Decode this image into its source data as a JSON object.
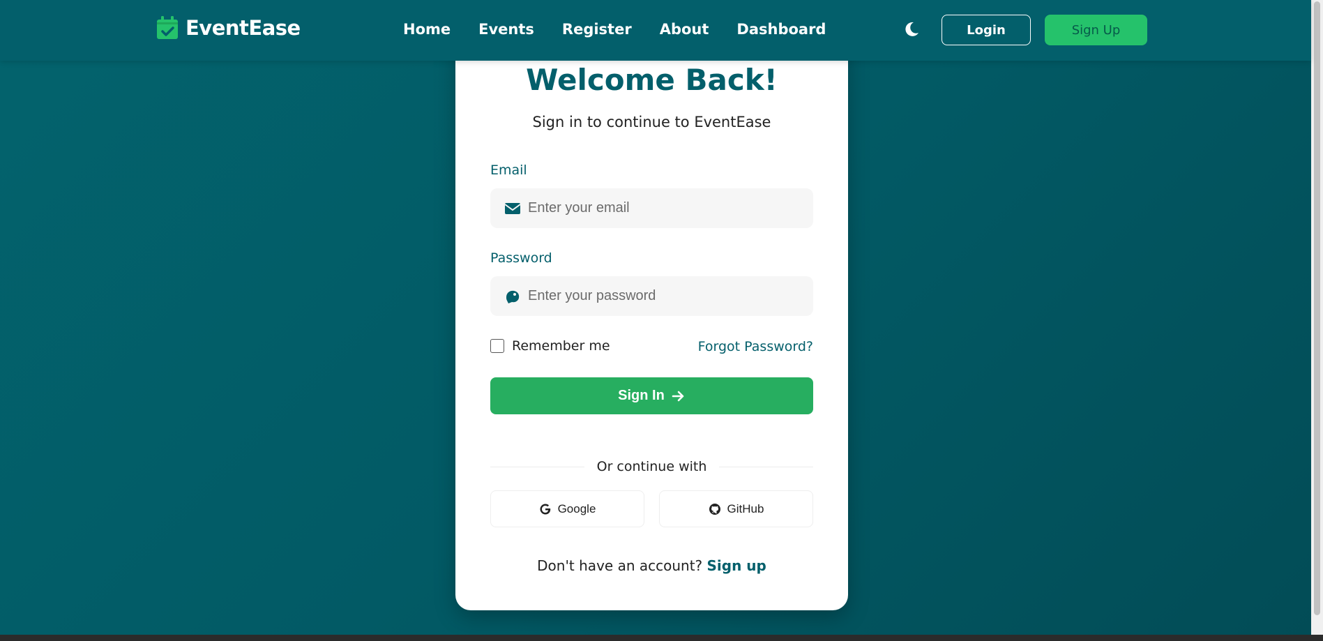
{
  "brand": {
    "name": "EventEase",
    "icon": "calendar-check-icon"
  },
  "nav": {
    "items": [
      {
        "label": "Home"
      },
      {
        "label": "Events"
      },
      {
        "label": "Register"
      },
      {
        "label": "About"
      },
      {
        "label": "Dashboard"
      }
    ],
    "theme_icon": "moon-icon",
    "login_label": "Login",
    "signup_label": "Sign Up"
  },
  "card": {
    "title": "Welcome Back!",
    "subtitle": "Sign in to continue to EventEase",
    "email": {
      "label": "Email",
      "placeholder": "Enter your email",
      "icon": "envelope-icon"
    },
    "password": {
      "label": "Password",
      "placeholder": "Enter your password",
      "icon": "key-icon"
    },
    "remember_label": "Remember me",
    "forgot_label": "Forgot Password?",
    "signin_label": "Sign In",
    "divider_text": "Or continue with",
    "google_label": "Google",
    "github_label": "GitHub",
    "footer_text": "Don't have an account?",
    "footer_link": "Sign up"
  },
  "colors": {
    "primary": "#045f6b",
    "accent_green": "#27ae60",
    "signup_green": "#25c26b",
    "background": "#03636d"
  }
}
